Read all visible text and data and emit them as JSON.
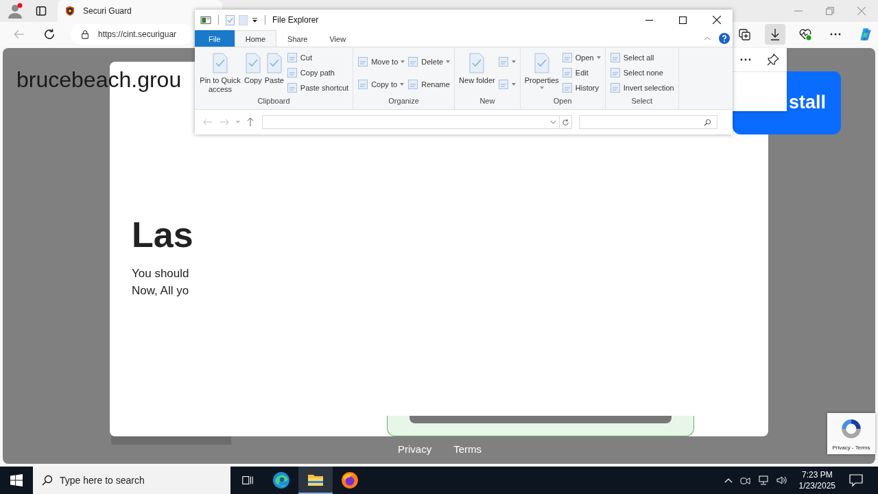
{
  "browser": {
    "tab": {
      "title": "Securi Guard",
      "selected": true
    },
    "address": "https://cint.securiguar",
    "toolbar": [
      {
        "kind": "collections",
        "selected": false
      },
      {
        "kind": "downloads",
        "selected": true
      },
      {
        "kind": "health",
        "selected": false
      },
      {
        "kind": "more",
        "selected": false
      },
      {
        "kind": "copilot",
        "selected": false
      }
    ]
  },
  "page": {
    "site_title": "brucebeach.grou",
    "heading": "Las",
    "lines": [
      "You should",
      "Now, All yo"
    ],
    "install_button": "stall",
    "footer_links": [
      "Privacy",
      "Terms"
    ],
    "recaptcha": "Privacy - Terms"
  },
  "explorer": {
    "title": "File Explorer",
    "tabs": [
      {
        "label": "File",
        "kind": "file",
        "selected": false
      },
      {
        "label": "Home",
        "kind": "tab",
        "selected": true
      },
      {
        "label": "Share",
        "kind": "tab",
        "selected": false
      },
      {
        "label": "View",
        "kind": "tab",
        "selected": false
      }
    ],
    "groups": [
      {
        "label": "Clipboard",
        "columns": [
          {
            "kind": "large",
            "items": [
              {
                "label": "Pin to Quick access"
              }
            ]
          },
          {
            "kind": "large",
            "items": [
              {
                "label": "Copy"
              }
            ]
          },
          {
            "kind": "large",
            "items": [
              {
                "label": "Paste"
              }
            ]
          },
          {
            "kind": "small",
            "items": [
              {
                "label": "Cut"
              },
              {
                "label": "Copy path"
              },
              {
                "label": "Paste shortcut"
              }
            ]
          }
        ]
      },
      {
        "label": "Organize",
        "columns": [
          {
            "kind": "small",
            "items": [
              {
                "label": "Move to",
                "dropdown": true
              },
              {
                "label": "Copy to",
                "dropdown": true
              }
            ]
          },
          {
            "kind": "small",
            "items": [
              {
                "label": "Delete",
                "dropdown": true
              },
              {
                "label": "Rename"
              }
            ]
          }
        ]
      },
      {
        "label": "New",
        "columns": [
          {
            "kind": "large",
            "items": [
              {
                "label": "New folder"
              }
            ]
          },
          {
            "kind": "small",
            "items": [
              {
                "dropdown": true
              },
              {
                "dropdown": true
              }
            ]
          }
        ]
      },
      {
        "label": "Open",
        "columns": [
          {
            "kind": "large",
            "items": [
              {
                "label": "Properties",
                "dropdown": true
              }
            ]
          },
          {
            "kind": "small",
            "items": [
              {
                "label": "Open",
                "dropdown": true
              },
              {
                "label": "Edit"
              },
              {
                "label": "History"
              }
            ]
          }
        ]
      },
      {
        "label": "Select",
        "columns": [
          {
            "kind": "small",
            "items": [
              {
                "label": "Select all"
              },
              {
                "label": "Select none"
              },
              {
                "label": "Invert selection"
              }
            ]
          }
        ]
      }
    ]
  },
  "taskbar": {
    "search_placeholder": "Type here to search",
    "time": "7:23 PM",
    "date": "1/23/2025",
    "apps": [
      {
        "kind": "edge",
        "selected": false
      },
      {
        "kind": "explorer",
        "selected": true
      },
      {
        "kind": "firefox",
        "selected": false
      }
    ]
  }
}
